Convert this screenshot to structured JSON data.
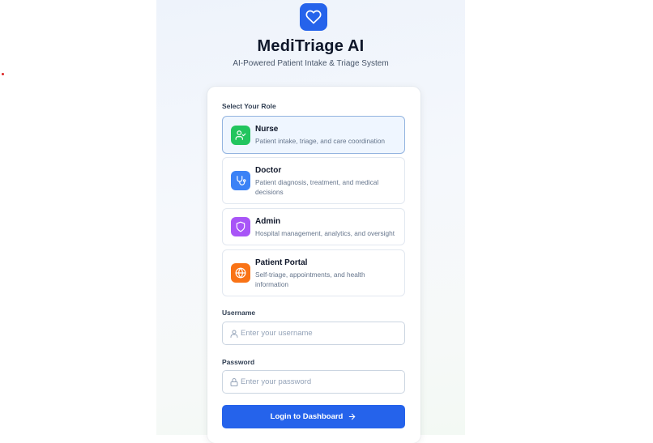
{
  "app": {
    "title": "MediTriage AI",
    "subtitle": "AI-Powered Patient Intake & Triage System",
    "logo_icon": "heart-icon",
    "brand_color": "#2563eb"
  },
  "roles": {
    "label": "Select Your Role",
    "selected": "nurse",
    "items": [
      {
        "id": "nurse",
        "title": "Nurse",
        "description": "Patient intake, triage, and care coordination",
        "icon": "user-check-icon",
        "color": "#22c55e"
      },
      {
        "id": "doctor",
        "title": "Doctor",
        "description": "Patient diagnosis, treatment, and medical decisions",
        "icon": "stethoscope-icon",
        "color": "#3b82f6"
      },
      {
        "id": "admin",
        "title": "Admin",
        "description": "Hospital management, analytics, and oversight",
        "icon": "shield-icon",
        "color": "#a855f7"
      },
      {
        "id": "patient-portal",
        "title": "Patient Portal",
        "description": "Self-triage, appointments, and health information",
        "icon": "globe-icon",
        "color": "#f97316"
      }
    ]
  },
  "form": {
    "username_label": "Username",
    "username_placeholder": "Enter your username",
    "username_value": "",
    "password_label": "Password",
    "password_placeholder": "Enter your password",
    "password_value": "",
    "submit_label": "Login to Dashboard"
  }
}
